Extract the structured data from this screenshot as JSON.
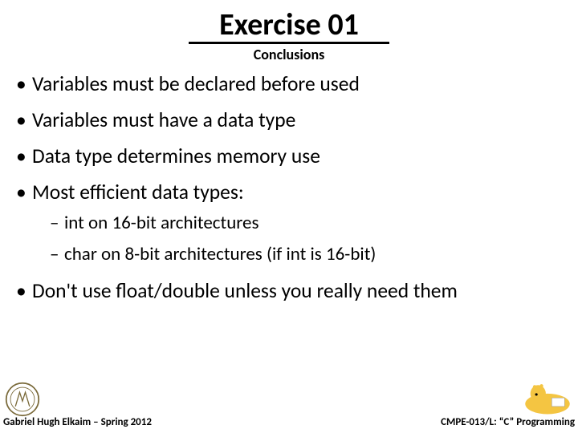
{
  "title": "Exercise 01",
  "subtitle": "Conclusions",
  "bullets": {
    "b0": "Variables must be declared before used",
    "b1": "Variables must have a data type",
    "b2": "Data type determines memory use",
    "b3": "Most efficient data types:",
    "b3_sub": {
      "s0": "int on 16-bit architectures",
      "s1": "char on 8-bit architectures (if int is 16-bit)"
    },
    "b4": "Don't use float/double unless you really need them"
  },
  "footer": {
    "left": "Gabriel Hugh Elkaim – Spring 2012",
    "right": "CMPE-013/L: “C” Programming"
  }
}
